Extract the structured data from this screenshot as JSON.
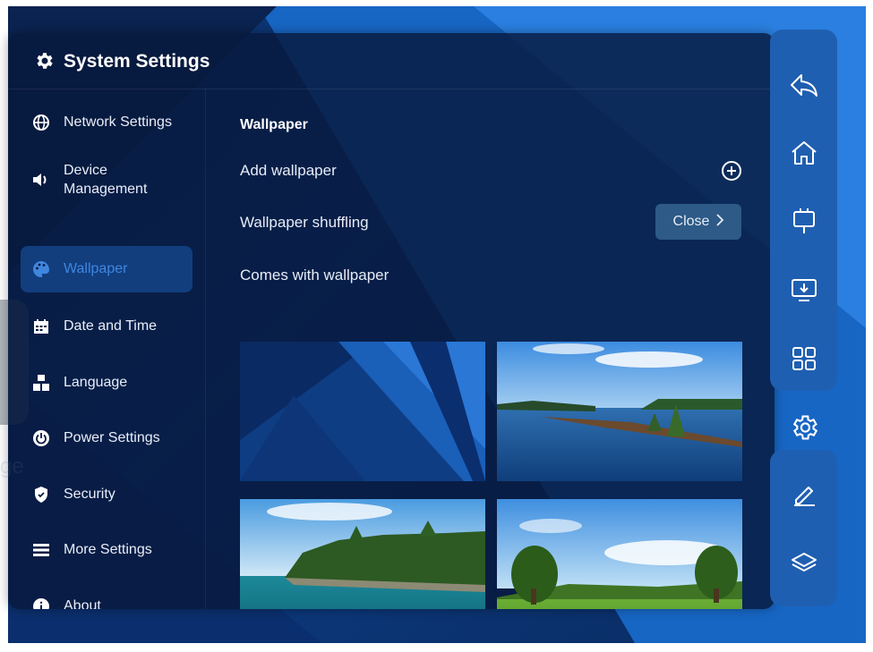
{
  "header": {
    "title": "System Settings"
  },
  "sidebar": {
    "items": [
      {
        "label": "Network Settings",
        "icon": "globe-icon"
      },
      {
        "label": "Device\nManagement",
        "icon": "speaker-icon"
      },
      {
        "label": "Wallpaper",
        "icon": "palette-icon",
        "active": true
      },
      {
        "label": "Date and Time",
        "icon": "calendar-icon"
      },
      {
        "label": "Language",
        "icon": "language-icon"
      },
      {
        "label": "Power Settings",
        "icon": "power-icon"
      },
      {
        "label": "Security",
        "icon": "shield-icon"
      },
      {
        "label": "More Settings",
        "icon": "list-icon"
      },
      {
        "label": "About",
        "icon": "info-icon"
      }
    ]
  },
  "main": {
    "section_title": "Wallpaper",
    "add_wallpaper": "Add wallpaper",
    "shuffling_label": "Wallpaper shuffling",
    "shuffling_value": "Close",
    "builtin_label": "Comes with wallpaper",
    "thumbnails": [
      "abstract-blue",
      "lake-islands",
      "forest-coast",
      "green-meadow"
    ]
  },
  "rightbar": {
    "icons": [
      "back-icon",
      "home-icon",
      "whiteboard-icon",
      "screen-share-icon",
      "apps-grid-icon",
      "settings-icon",
      "pen-icon",
      "layers-icon"
    ]
  },
  "background": {
    "ghost_text": "ge"
  },
  "colors": {
    "accent": "#3f86df",
    "panel": "#07193c",
    "rightbar": "#1f5fb1"
  }
}
